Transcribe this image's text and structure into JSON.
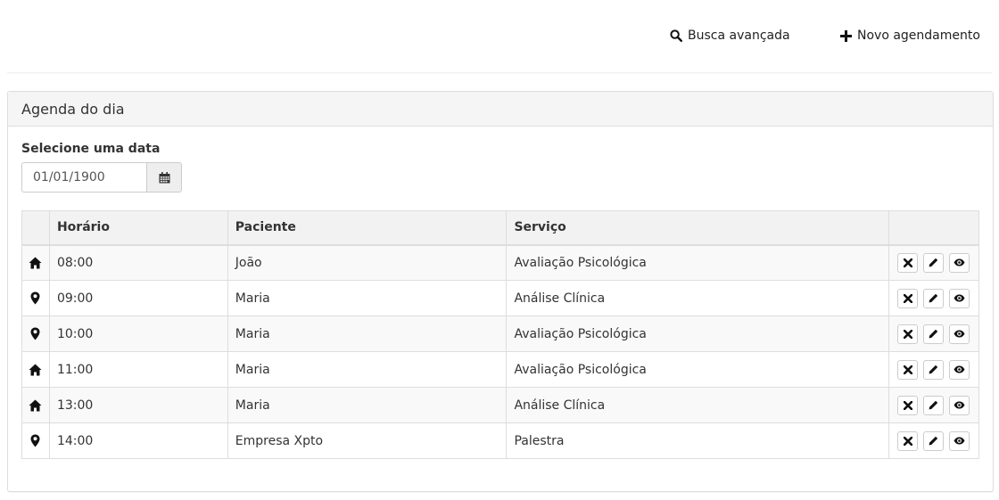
{
  "header": {
    "advanced_search_label": "Busca avançada",
    "advanced_search_icon": "search-icon",
    "new_appointment_label": "Novo agendamento",
    "new_appointment_icon": "plus-icon"
  },
  "panel": {
    "title": "Agenda do dia",
    "date_label": "Selecione uma data",
    "date_value": "01/01/1900",
    "calendar_icon": "calendar-icon"
  },
  "table": {
    "columns": [
      "",
      "Horário",
      "Paciente",
      "Serviço",
      ""
    ],
    "rows": [
      {
        "location_icon": "home-icon",
        "time": "08:00",
        "patient": "João",
        "service": "Avaliação Psicológica"
      },
      {
        "location_icon": "map-marker-icon",
        "time": "09:00",
        "patient": "Maria",
        "service": "Análise Clínica"
      },
      {
        "location_icon": "map-marker-icon",
        "time": "10:00",
        "patient": "Maria",
        "service": "Avaliação Psicológica"
      },
      {
        "location_icon": "home-icon",
        "time": "11:00",
        "patient": "Maria",
        "service": "Avaliação Psicológica"
      },
      {
        "location_icon": "home-icon",
        "time": "13:00",
        "patient": "Maria",
        "service": "Análise Clínica"
      },
      {
        "location_icon": "map-marker-icon",
        "time": "14:00",
        "patient": "Empresa Xpto",
        "service": "Palestra"
      }
    ],
    "row_actions": [
      "delete-icon",
      "edit-icon",
      "view-icon"
    ]
  }
}
